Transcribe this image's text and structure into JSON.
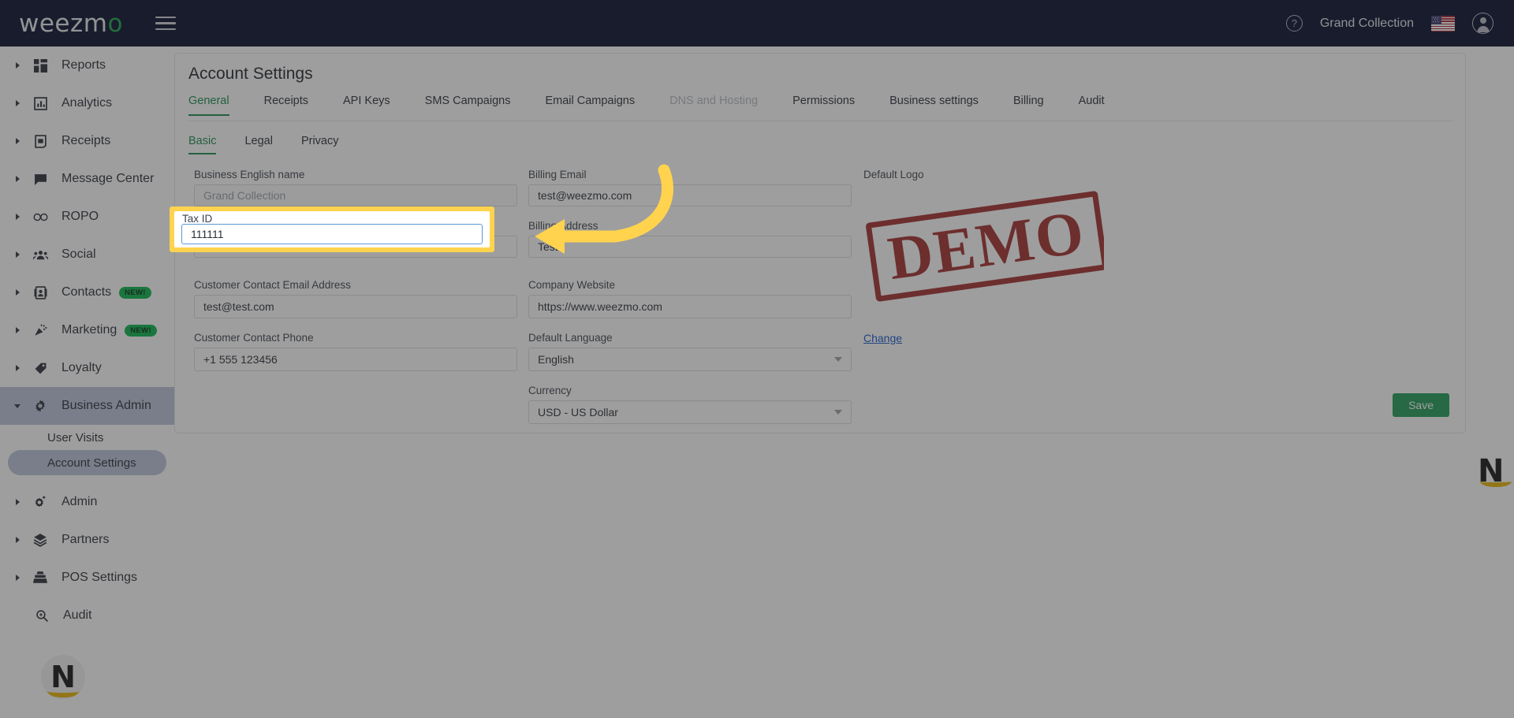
{
  "topbar": {
    "logo_text": "weezm",
    "logo_accent": "o",
    "menu_icon": "hamburger-icon",
    "help_label": "?",
    "account_name": "Grand Collection",
    "flag": "us-flag-icon",
    "avatar": "user-avatar-icon"
  },
  "sidebar": {
    "items": [
      {
        "label": "Reports",
        "icon": "dashboard-icon",
        "badge": "",
        "expandable": true
      },
      {
        "label": "Analytics",
        "icon": "bar-chart-icon",
        "badge": "",
        "expandable": true
      },
      {
        "label": "Receipts",
        "icon": "receipt-icon",
        "badge": "",
        "expandable": true
      },
      {
        "label": "Message Center",
        "icon": "chat-bubble-icon",
        "badge": "",
        "expandable": true
      },
      {
        "label": "ROPO",
        "icon": "infinity-icon",
        "badge": "",
        "expandable": true
      },
      {
        "label": "Social",
        "icon": "people-icon",
        "badge": "",
        "expandable": true
      },
      {
        "label": "Contacts",
        "icon": "contact-card-icon",
        "badge": "NEW!",
        "expandable": true
      },
      {
        "label": "Marketing",
        "icon": "megaphone-icon",
        "badge": "NEW!",
        "expandable": true
      },
      {
        "label": "Loyalty",
        "icon": "tag-icon",
        "badge": "",
        "expandable": true
      },
      {
        "label": "Business Admin",
        "icon": "gear-icon",
        "badge": "",
        "expandable": true
      }
    ],
    "business_admin_children": [
      {
        "label": "User Visits",
        "selected": false
      },
      {
        "label": "Account Settings",
        "selected": true
      }
    ],
    "items_after": [
      {
        "label": "Admin",
        "icon": "gear-plus-icon",
        "badge": "",
        "expandable": true
      },
      {
        "label": "Partners",
        "icon": "layers-icon",
        "badge": "",
        "expandable": true
      },
      {
        "label": "POS Settings",
        "icon": "cash-register-icon",
        "badge": "",
        "expandable": true
      }
    ],
    "audit": {
      "label": "Audit",
      "icon": "search-icon"
    },
    "brand_avatar_letter": "N"
  },
  "main": {
    "page_title": "Account Settings",
    "tabs": [
      {
        "label": "General",
        "state": "active"
      },
      {
        "label": "Receipts",
        "state": "normal"
      },
      {
        "label": "API Keys",
        "state": "normal"
      },
      {
        "label": "SMS Campaigns",
        "state": "normal"
      },
      {
        "label": "Email Campaigns",
        "state": "normal"
      },
      {
        "label": "DNS and Hosting",
        "state": "disabled"
      },
      {
        "label": "Permissions",
        "state": "normal"
      },
      {
        "label": "Business settings",
        "state": "normal"
      },
      {
        "label": "Billing",
        "state": "normal"
      },
      {
        "label": "Audit",
        "state": "normal"
      }
    ],
    "subtabs": [
      {
        "label": "Basic",
        "state": "active"
      },
      {
        "label": "Legal",
        "state": "normal"
      },
      {
        "label": "Privacy",
        "state": "normal"
      }
    ],
    "fields_left": [
      {
        "label": "Business English name",
        "value": "Grand Collection",
        "is_placeholder": true,
        "type": "text"
      },
      {
        "label": "Tax ID",
        "value": "111111",
        "is_placeholder": false,
        "type": "text"
      },
      {
        "label": "Customer Contact Email Address",
        "value": "test@test.com",
        "is_placeholder": false,
        "type": "text"
      },
      {
        "label": "Customer Contact Phone",
        "value": "+1 555 123456",
        "is_placeholder": false,
        "type": "text"
      }
    ],
    "fields_mid": [
      {
        "label": "Billing Email",
        "value": "test@weezmo.com",
        "is_placeholder": false,
        "type": "text"
      },
      {
        "label": "Billing Address",
        "value": "Test",
        "is_placeholder": false,
        "type": "text"
      },
      {
        "label": "Company Website",
        "value": "https://www.weezmo.com",
        "is_placeholder": false,
        "type": "text"
      },
      {
        "label": "Default Language",
        "value": "English",
        "is_placeholder": false,
        "type": "select"
      },
      {
        "label": "Currency",
        "value": "USD - US Dollar",
        "is_placeholder": false,
        "type": "select"
      }
    ],
    "logo_section": {
      "label": "Default Logo",
      "stamp_text": "DEMO",
      "change_link": "Change"
    },
    "save_label": "Save",
    "corner_logo_letter": "N"
  },
  "annotation": {
    "highlight_field_label": "Tax ID",
    "highlight_field_value": "111111",
    "highlight_color": "#ffd34e",
    "arrow_color": "#ffd34e",
    "arrow_name": "pointer-arrow"
  },
  "colors": {
    "topbar_bg": "#040a29",
    "accent_green": "#1a8a4e",
    "save_green": "#1d9c55",
    "link_blue": "#1155cc",
    "badge_green": "#07b44a",
    "stamp_red": "#9b1b1b",
    "selected_nav": "#b9c3da"
  }
}
